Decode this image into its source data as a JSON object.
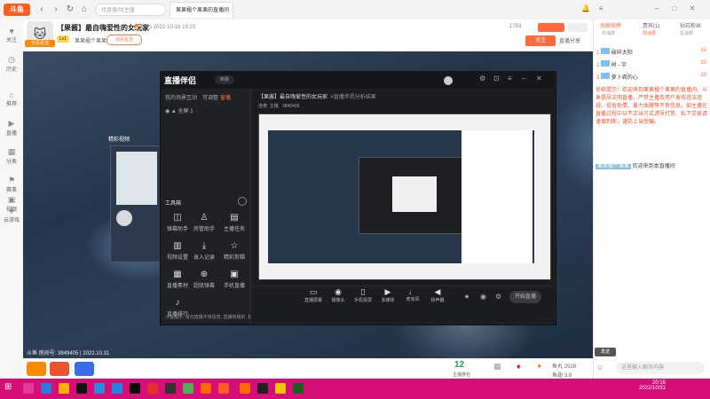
{
  "browser": {
    "logo": "斗鱼",
    "search_placeholder": "找直播/找主播",
    "tab_title": "果果楹个果果的直播间"
  },
  "leftbar": {
    "items": [
      {
        "icon": "heart-icon",
        "label": "关注"
      },
      {
        "icon": "history-icon",
        "label": "历史"
      },
      {
        "icon": "home-icon",
        "label": "推荐"
      },
      {
        "icon": "live-icon",
        "label": "直播"
      },
      {
        "icon": "category-icon",
        "label": "分类"
      },
      {
        "icon": "match-icon",
        "label": "赛事"
      },
      {
        "icon": "video-icon",
        "label": "视频"
      },
      {
        "icon": "game-icon",
        "label": "云游戏"
      }
    ]
  },
  "header": {
    "title": "【果酱】最自嗨爱性的女玩家",
    "heat": "0",
    "time": "2022-10-18 19:23",
    "level": "Lv1",
    "streamer": "果果楹个果果",
    "tag": "全民星选",
    "viewers": "1783",
    "follow_label": "关注",
    "share_label": "直播分享"
  },
  "video": {
    "overlay_title": "精彩视频",
    "caption": "斗鱼 房间号: 3849405 | 2022.10.31"
  },
  "obs": {
    "logo": "直播伴侣",
    "version": "新版",
    "tabs": [
      "我的场景",
      "互动",
      "可调整",
      "窗播"
    ],
    "scene_name": "全屏 1",
    "tools_title": "工具箱",
    "tools": [
      {
        "icon": "camera-icon",
        "label": "弹幕助手"
      },
      {
        "icon": "user-icon",
        "label": "房管助手"
      },
      {
        "icon": "image-icon",
        "label": "主播任务"
      },
      {
        "icon": "chart-icon",
        "label": "视频设置"
      },
      {
        "icon": "download-icon",
        "label": "录入记录"
      },
      {
        "icon": "star-icon",
        "label": "精彩剪辑"
      },
      {
        "icon": "document-icon",
        "label": "直播素材"
      },
      {
        "icon": "gift-icon",
        "label": "超级弹幕"
      },
      {
        "icon": "record-icon",
        "label": "手机直播"
      },
      {
        "icon": "music-icon",
        "label": "直播排行"
      }
    ],
    "main_title": "【果酱】最自嗨爱性的女玩家",
    "main_sub": "#直播伴侣分析结果",
    "stats": [
      "连麦: 主播",
      "3849405"
    ],
    "controls": [
      {
        "icon": "screen-icon",
        "label": "直播屏幕"
      },
      {
        "icon": "camera-icon",
        "label": "摄像头"
      },
      {
        "icon": "phone-icon",
        "label": "手机投屏"
      },
      {
        "icon": "video-icon",
        "label": "多媒体"
      },
      {
        "icon": "mic-icon",
        "label": "麦克风"
      },
      {
        "icon": "speaker-icon",
        "label": "扬声器"
      }
    ],
    "start_label": "开始直播",
    "notice": "斗鱼提示: 请勿直播不良信息, 直播有组织, 禁止一切违规"
  },
  "right": {
    "tabs": [
      "贡献周榜",
      "贵宾(1)",
      "钻石粉丝"
    ],
    "subtabs": [
      "日消费",
      "周消费",
      "总消费"
    ],
    "ranks": [
      {
        "num": "1",
        "name": "破碎太阳",
        "value": "10"
      },
      {
        "num": "2",
        "name": "树 - 宇",
        "value": "10"
      },
      {
        "num": "3",
        "name": "萝卜君的心",
        "value": "10"
      }
    ],
    "system_msg": "系统提示：欢迎来到果果楹个果果的直播间。斗鱼倡导文明直播，严禁主播及用户发布违法违规、低俗色情、暴力血腥等不良信息。如主播在直播过程中以不正当方式诱导打赏、私下交易请谨慎判断，谨防上当受骗。",
    "welcome_msg": "欢迎来到本直播间",
    "welcome_user": "果果楹个果果",
    "input_placeholder": "这里输入聊天内容",
    "send_label": "发送"
  },
  "below": {
    "rank_num": "12",
    "rank_label": "主播排名",
    "gifts": [
      "鱼丸",
      "荧光棒",
      "办卡",
      "粉丝牌"
    ],
    "fish_label": "鱼丸",
    "fish_value": "2528",
    "balance_label": "鱼翅",
    "balance_value": "3.8"
  },
  "taskbar": {
    "time": "20:16",
    "date": "2022/10/31"
  }
}
